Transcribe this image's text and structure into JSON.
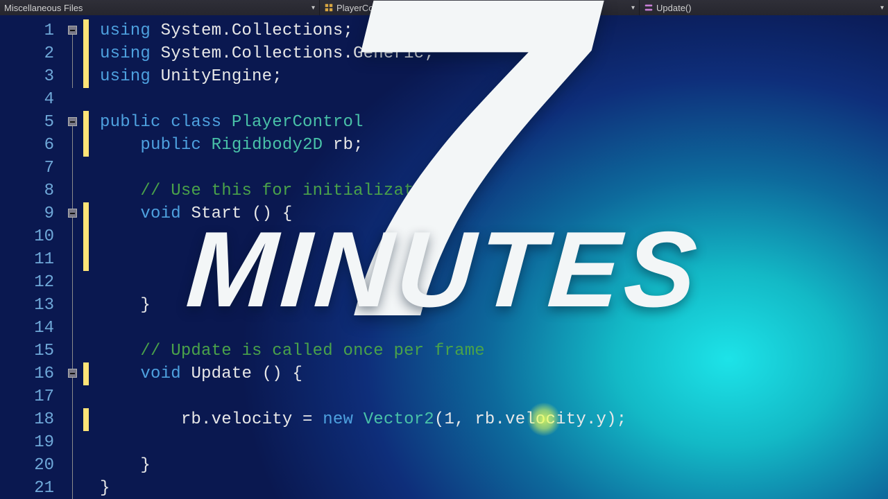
{
  "breadcrumb": {
    "scope": "Miscellaneous Files",
    "class": "PlayerControls",
    "member": "Update()"
  },
  "overlay": {
    "big_number": "7",
    "word": "MINUTES"
  },
  "editor": {
    "current_line": 18,
    "line_numbers": [
      "1",
      "2",
      "3",
      "4",
      "5",
      "6",
      "7",
      "8",
      "9",
      "10",
      "11",
      "12",
      "13",
      "14",
      "15",
      "16",
      "17",
      "18",
      "19",
      "20",
      "21"
    ],
    "folds": [
      {
        "line": 1,
        "kind": "box"
      },
      {
        "line": 5,
        "kind": "box"
      },
      {
        "line": 9,
        "kind": "box"
      },
      {
        "line": 16,
        "kind": "box"
      }
    ],
    "mod_ranges": [
      {
        "from": 1,
        "to": 3
      },
      {
        "from": 5,
        "to": 6
      },
      {
        "from": 9,
        "to": 11
      },
      {
        "from": 16,
        "to": 16
      },
      {
        "from": 18,
        "to": 18
      }
    ],
    "code_lines": [
      {
        "tokens": [
          {
            "c": "kw",
            "t": "using"
          },
          {
            "c": "pln",
            "t": " System.Collections;"
          }
        ]
      },
      {
        "tokens": [
          {
            "c": "kw",
            "t": "using"
          },
          {
            "c": "pln",
            "t": " System.Collections.Generic;"
          }
        ]
      },
      {
        "tokens": [
          {
            "c": "kw",
            "t": "using"
          },
          {
            "c": "pln",
            "t": " UnityEngine;"
          }
        ]
      },
      {
        "tokens": []
      },
      {
        "tokens": [
          {
            "c": "kw",
            "t": "public class"
          },
          {
            "c": "pln",
            "t": " "
          },
          {
            "c": "typ",
            "t": "PlayerControl"
          }
        ]
      },
      {
        "tokens": [
          {
            "c": "pln",
            "t": "    "
          },
          {
            "c": "kw",
            "t": "public"
          },
          {
            "c": "pln",
            "t": " "
          },
          {
            "c": "typ",
            "t": "Rigidbody2D"
          },
          {
            "c": "pln",
            "t": " rb;"
          }
        ]
      },
      {
        "tokens": []
      },
      {
        "tokens": [
          {
            "c": "pln",
            "t": "    "
          },
          {
            "c": "cmt",
            "t": "// Use this for initialization"
          }
        ]
      },
      {
        "tokens": [
          {
            "c": "pln",
            "t": "    "
          },
          {
            "c": "kw",
            "t": "void"
          },
          {
            "c": "pln",
            "t": " Start () {"
          }
        ]
      },
      {
        "tokens": []
      },
      {
        "tokens": [
          {
            "c": "pln",
            "t": "        "
          }
        ]
      },
      {
        "tokens": []
      },
      {
        "tokens": [
          {
            "c": "pln",
            "t": "    }"
          }
        ]
      },
      {
        "tokens": []
      },
      {
        "tokens": [
          {
            "c": "pln",
            "t": "    "
          },
          {
            "c": "cmt",
            "t": "// Update is called once per frame"
          }
        ]
      },
      {
        "tokens": [
          {
            "c": "pln",
            "t": "    "
          },
          {
            "c": "kw",
            "t": "void"
          },
          {
            "c": "pln",
            "t": " Update () {"
          }
        ]
      },
      {
        "tokens": []
      },
      {
        "tokens": [
          {
            "c": "pln",
            "t": "        rb.velocity = "
          },
          {
            "c": "kw",
            "t": "new"
          },
          {
            "c": "pln",
            "t": " "
          },
          {
            "c": "typ",
            "t": "Vector2"
          },
          {
            "c": "pln",
            "t": "(1, rb.velocity.y);"
          }
        ]
      },
      {
        "tokens": []
      },
      {
        "tokens": [
          {
            "c": "pln",
            "t": "    }"
          }
        ]
      },
      {
        "tokens": [
          {
            "c": "pln",
            "t": "}"
          }
        ]
      }
    ]
  }
}
